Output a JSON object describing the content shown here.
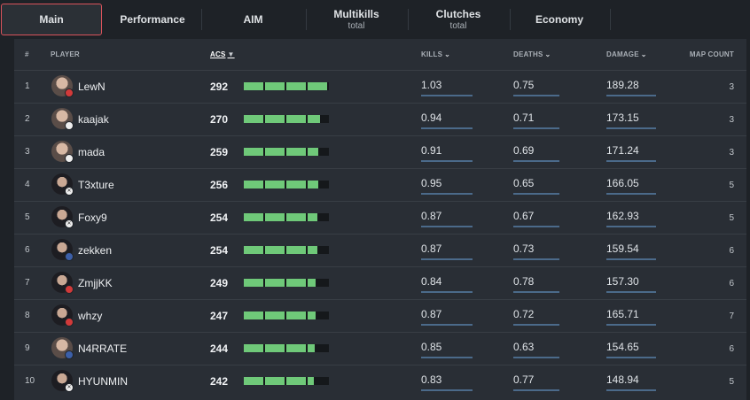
{
  "tabs": [
    {
      "label": "Main",
      "sub": ""
    },
    {
      "label": "Performance",
      "sub": ""
    },
    {
      "label": "AIM",
      "sub": ""
    },
    {
      "label": "Multikills",
      "sub": "total"
    },
    {
      "label": "Clutches",
      "sub": "total"
    },
    {
      "label": "Economy",
      "sub": ""
    }
  ],
  "columns": {
    "rank": "#",
    "player": "PLAYER",
    "acs": "ACS",
    "kills": "KILLS",
    "deaths": "DEATHS",
    "damage": "DAMAGE",
    "map_count": "MAP COUNT"
  },
  "colors": {
    "accent": "#d9535b",
    "bar_fill": "#6fc979",
    "bar_track": "#15181b",
    "stat_line": "#4b6a8a"
  },
  "rows": [
    {
      "rank": "1",
      "player": "LewN",
      "acs": "292",
      "acs_fraction": 0.98,
      "kills": "1.03",
      "deaths": "0.75",
      "damage": "189.28",
      "maps": "3",
      "flag": "tr",
      "avatar": "light"
    },
    {
      "rank": "2",
      "player": "kaajak",
      "acs": "270",
      "acs_fraction": 0.9,
      "kills": "0.94",
      "deaths": "0.71",
      "damage": "173.15",
      "maps": "3",
      "flag": "pl",
      "avatar": "light"
    },
    {
      "rank": "3",
      "player": "mada",
      "acs": "259",
      "acs_fraction": 0.88,
      "kills": "0.91",
      "deaths": "0.69",
      "damage": "171.24",
      "maps": "3",
      "flag": "ca",
      "avatar": "light"
    },
    {
      "rank": "4",
      "player": "T3xture",
      "acs": "256",
      "acs_fraction": 0.87,
      "kills": "0.95",
      "deaths": "0.65",
      "damage": "166.05",
      "maps": "5",
      "flag": "x",
      "avatar": "dark"
    },
    {
      "rank": "5",
      "player": "Foxy9",
      "acs": "254",
      "acs_fraction": 0.86,
      "kills": "0.87",
      "deaths": "0.67",
      "damage": "162.93",
      "maps": "5",
      "flag": "x",
      "avatar": "dark"
    },
    {
      "rank": "6",
      "player": "zekken",
      "acs": "254",
      "acs_fraction": 0.86,
      "kills": "0.87",
      "deaths": "0.73",
      "damage": "159.54",
      "maps": "6",
      "flag": "us",
      "avatar": "dark"
    },
    {
      "rank": "7",
      "player": "ZmjjKK",
      "acs": "249",
      "acs_fraction": 0.84,
      "kills": "0.84",
      "deaths": "0.78",
      "damage": "157.30",
      "maps": "6",
      "flag": "cn",
      "avatar": "dark"
    },
    {
      "rank": "8",
      "player": "whzy",
      "acs": "247",
      "acs_fraction": 0.84,
      "kills": "0.87",
      "deaths": "0.72",
      "damage": "165.71",
      "maps": "7",
      "flag": "cn",
      "avatar": "dark"
    },
    {
      "rank": "9",
      "player": "N4RRATE",
      "acs": "244",
      "acs_fraction": 0.83,
      "kills": "0.85",
      "deaths": "0.63",
      "damage": "154.65",
      "maps": "6",
      "flag": "us",
      "avatar": "light"
    },
    {
      "rank": "10",
      "player": "HYUNMIN",
      "acs": "242",
      "acs_fraction": 0.82,
      "kills": "0.83",
      "deaths": "0.77",
      "damage": "148.94",
      "maps": "5",
      "flag": "x",
      "avatar": "dark"
    }
  ]
}
